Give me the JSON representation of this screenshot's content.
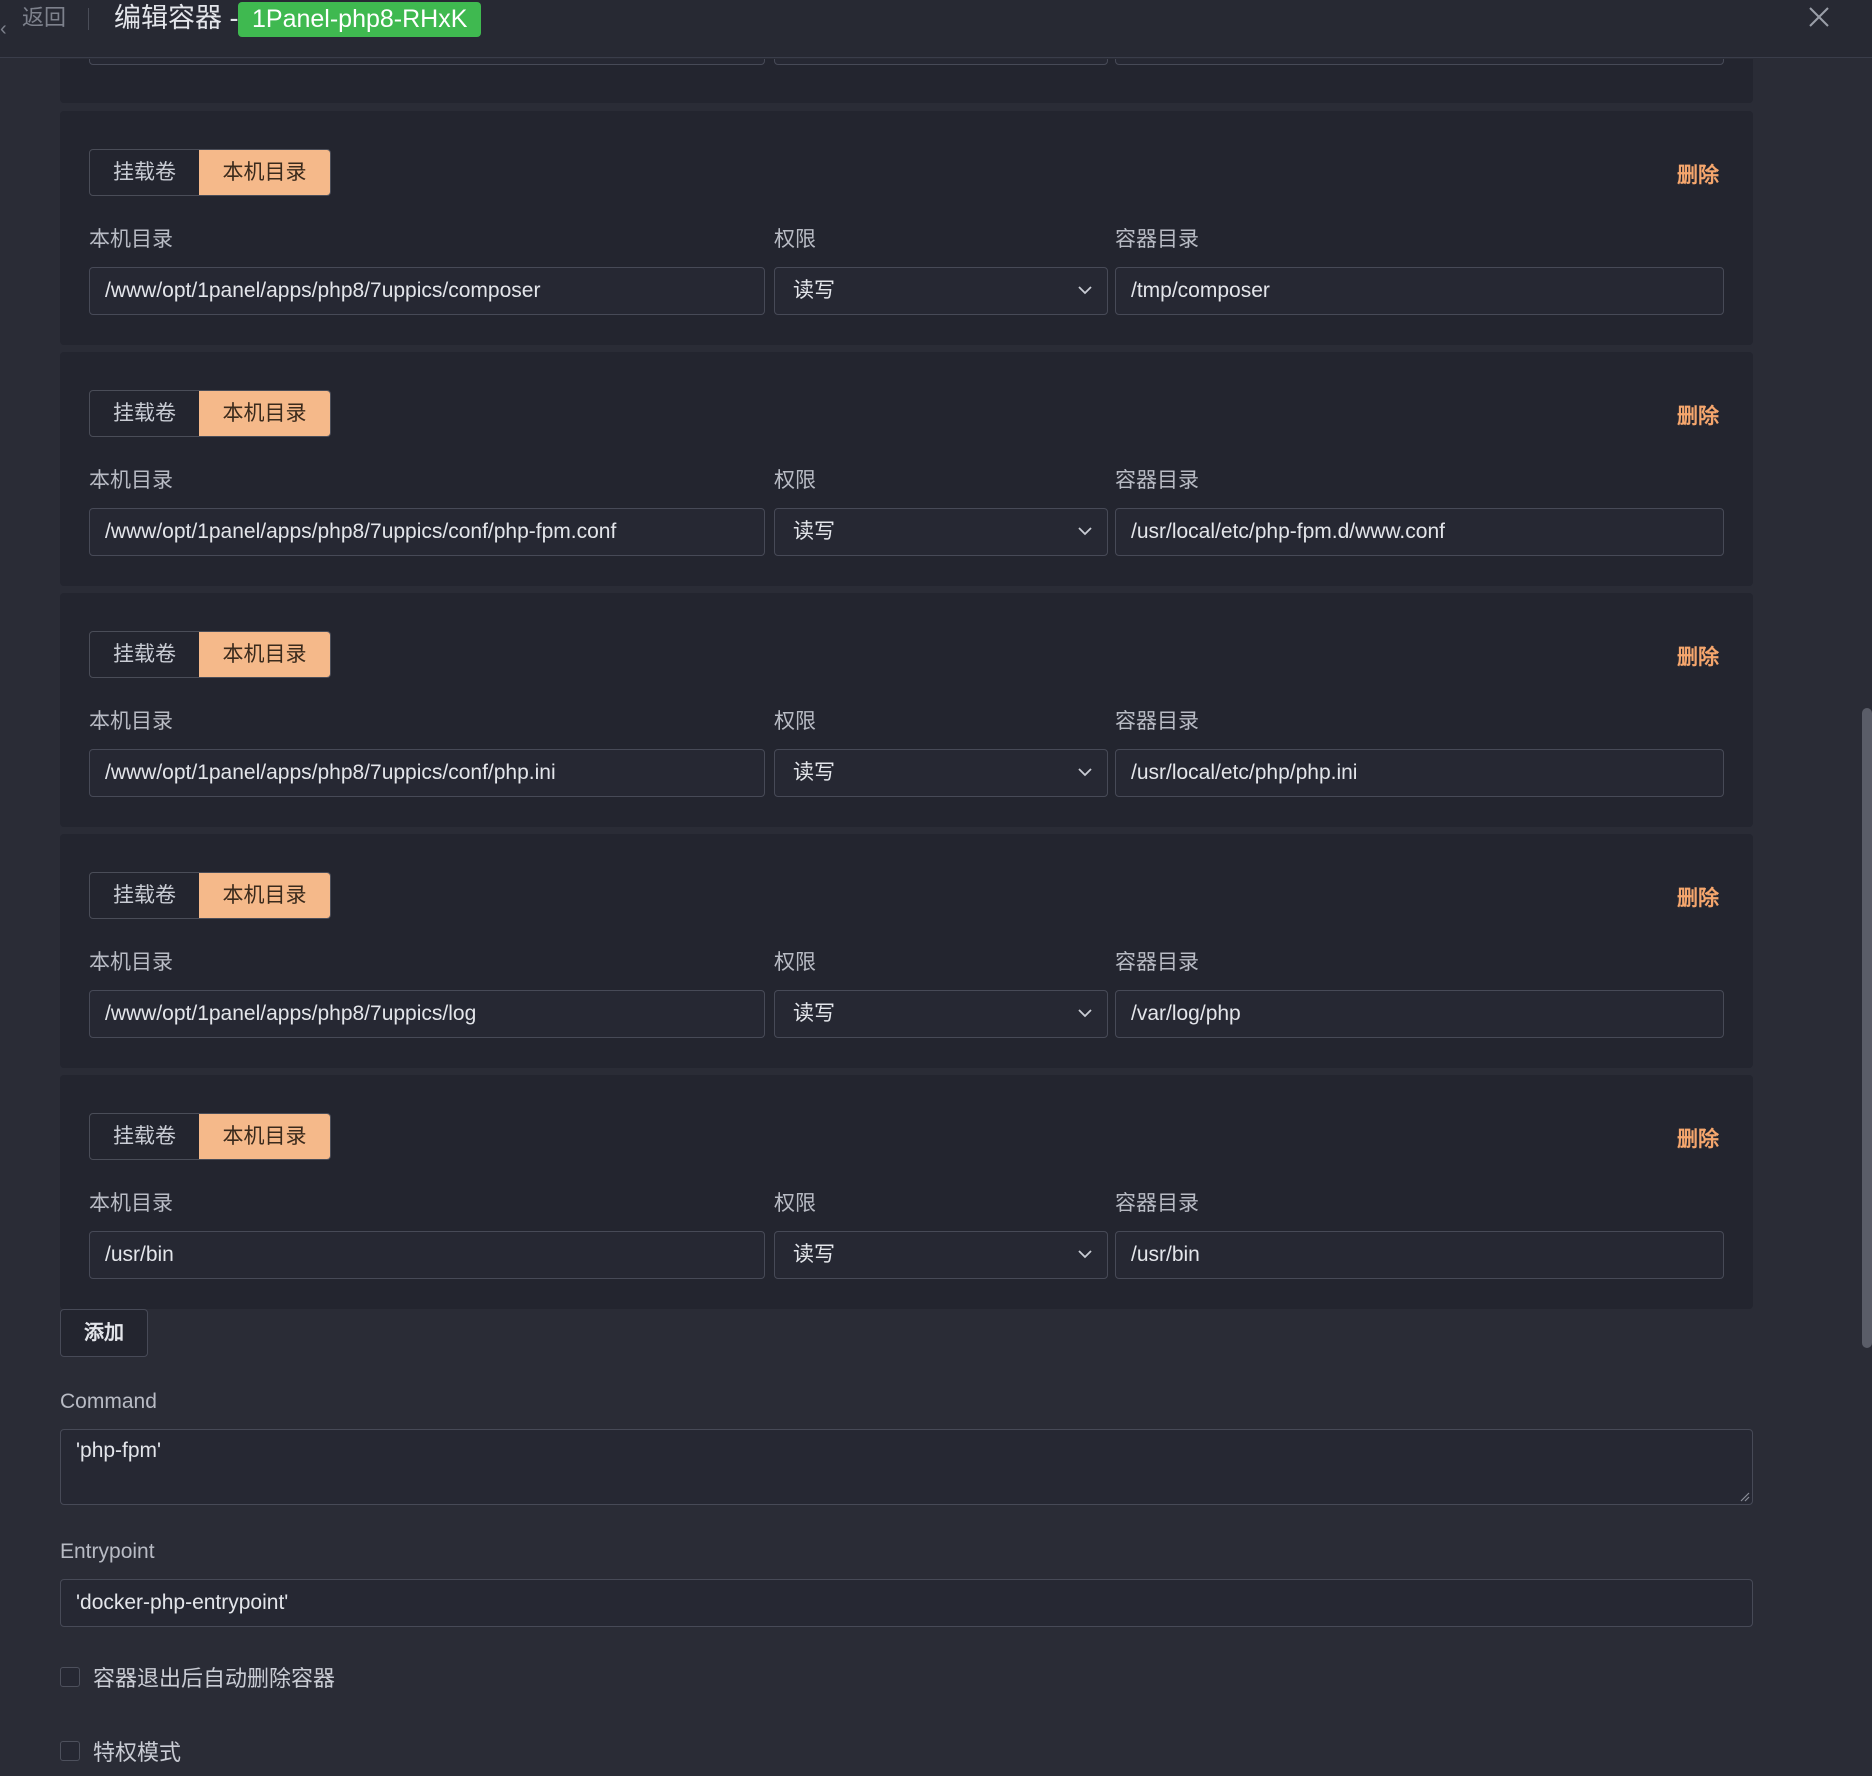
{
  "header": {
    "back_label": "返回",
    "title": "编辑容器 -",
    "container_name": "1Panel-php8-RHxK"
  },
  "labels": {
    "host_dir": "本机目录",
    "permission": "权限",
    "container_dir": "容器目录",
    "seg_volume": "挂载卷",
    "seg_host": "本机目录",
    "delete": "删除"
  },
  "mounts": [
    {
      "host_path": "/www/opt/1panel/apps/php8/7uppics/composer",
      "permission": "读写",
      "container_path": "/tmp/composer"
    },
    {
      "host_path": "/www/opt/1panel/apps/php8/7uppics/conf/php-fpm.conf",
      "permission": "读写",
      "container_path": "/usr/local/etc/php-fpm.d/www.conf"
    },
    {
      "host_path": "/www/opt/1panel/apps/php8/7uppics/conf/php.ini",
      "permission": "读写",
      "container_path": "/usr/local/etc/php/php.ini"
    },
    {
      "host_path": "/www/opt/1panel/apps/php8/7uppics/log",
      "permission": "读写",
      "container_path": "/var/log/php"
    },
    {
      "host_path": "/usr/bin",
      "permission": "读写",
      "container_path": "/usr/bin"
    }
  ],
  "add_label": "添加",
  "command": {
    "label": "Command",
    "value": "'php-fpm'"
  },
  "entrypoint": {
    "label": "Entrypoint",
    "value": "'docker-php-entrypoint'"
  },
  "options": {
    "auto_remove": {
      "label": "容器退出后自动删除容器",
      "checked": false
    },
    "privileged": {
      "label": "特权模式",
      "checked": false
    }
  },
  "colors": {
    "accent": "#f5b98a",
    "tag_green": "#3fb950",
    "background": "#2a2c36",
    "card": "#23252f"
  }
}
